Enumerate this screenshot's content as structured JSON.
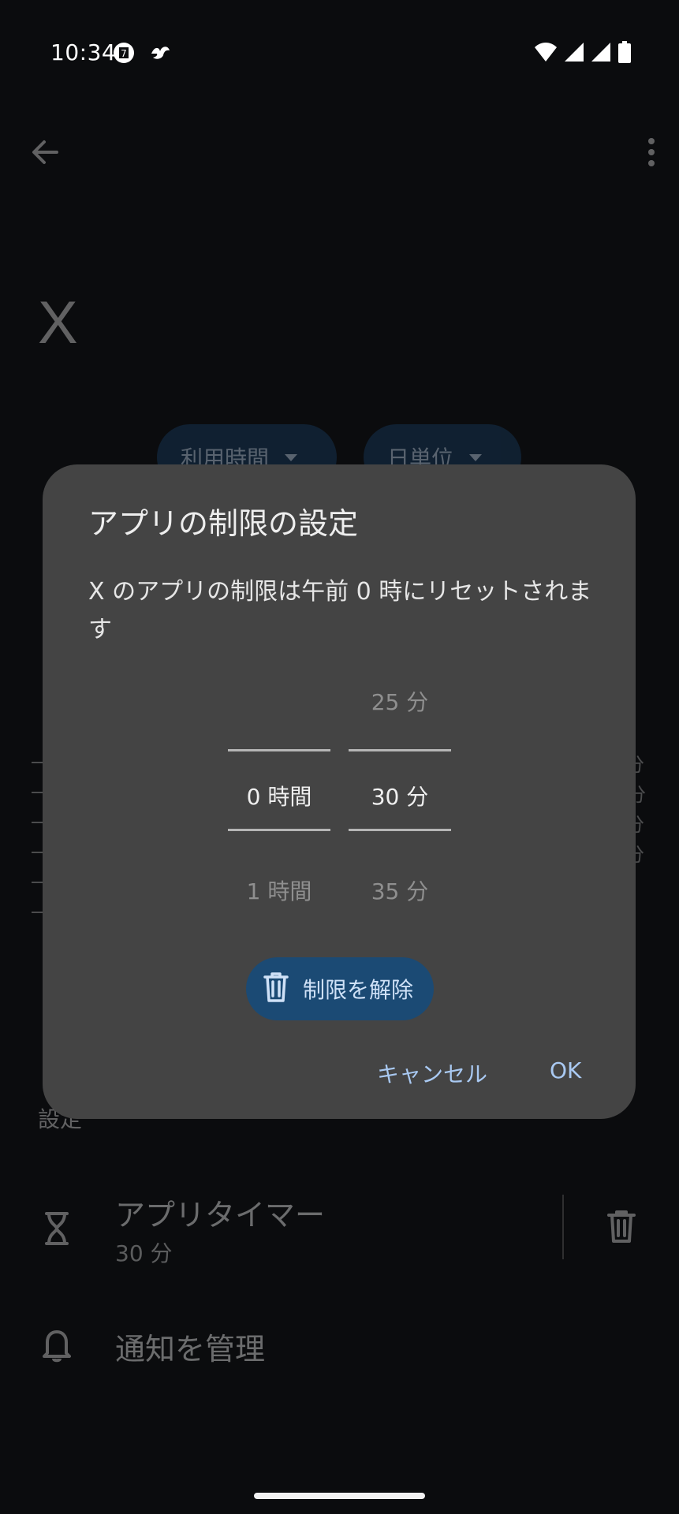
{
  "status_bar": {
    "time": "10:34",
    "icons_left": [
      "seven-eleven-icon",
      "bird-icon"
    ],
    "icons_right": [
      "wifi-icon",
      "signal-icon",
      "signal-icon",
      "battery-icon"
    ]
  },
  "background_page": {
    "app_name": "X",
    "chips": [
      {
        "label": "利用時間"
      },
      {
        "label": "日単位"
      }
    ],
    "chart_ticks": [
      "分",
      "分",
      "分",
      "分"
    ],
    "settings_section": "設定",
    "app_timer": {
      "title": "アプリタイマー",
      "value": "30 分"
    },
    "notifications": {
      "title": "通知を管理"
    }
  },
  "dialog": {
    "title": "アプリの制限の設定",
    "description": "X のアプリの制限は午前 0 時にリセットされます",
    "hours_picker": {
      "above": "",
      "selected": "0 時間",
      "below": "1 時間"
    },
    "minutes_picker": {
      "above": "25 分",
      "selected": "30 分",
      "below": "35 分"
    },
    "remove_button_label": "制限を解除",
    "cancel_label": "キャンセル",
    "ok_label": "OK"
  },
  "colors": {
    "background": "#0b0c0e",
    "dialog": "#444444",
    "accent": "#a9c9f2",
    "tonal_button": "#1b4a74"
  }
}
